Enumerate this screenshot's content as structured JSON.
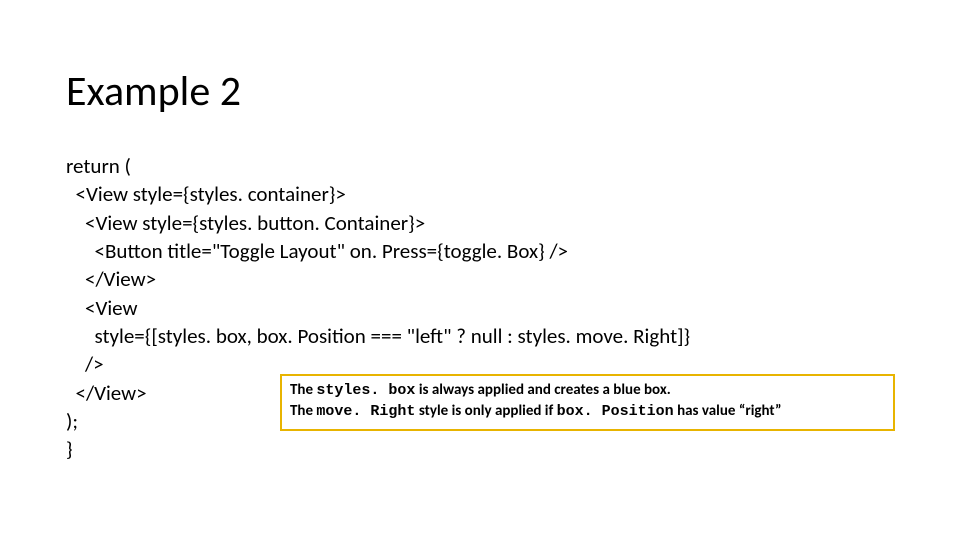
{
  "slide": {
    "title": "Example 2",
    "code": {
      "l1": "return (",
      "l2": "  <View style={styles. container}>",
      "l3": "    <View style={styles. button. Container}>",
      "l4": "      <Button title=\"Toggle Layout\" on. Press={toggle. Box} />",
      "l5": "    </View>",
      "l6": "    <View",
      "l7": "      style={[styles. box, box. Position === \"left\" ? null : styles. move. Right]}",
      "l8": "    />",
      "l9": "  </View>",
      "l10": ");",
      "l11": "}"
    },
    "callout": {
      "line1_pre": "The ",
      "line1_code": "styles. box",
      "line1_post": "  is always applied and creates a blue box.",
      "line2_pre": "The ",
      "line2_code": "move. Right",
      "line2_mid": " style is only applied if ",
      "line2_code2": "box. Position",
      "line2_post": " has value “right”"
    }
  }
}
